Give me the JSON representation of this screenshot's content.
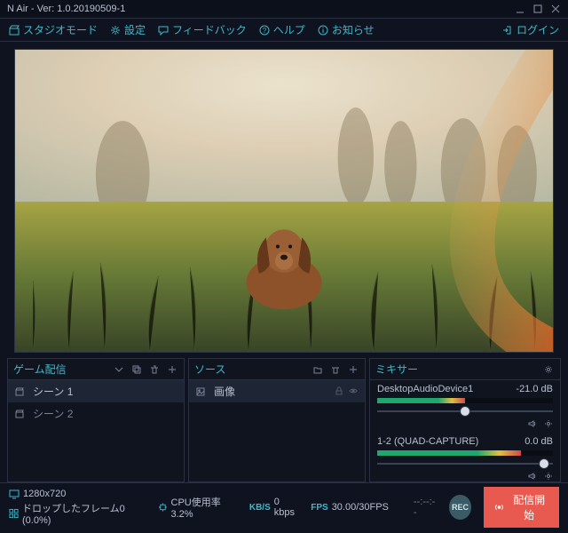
{
  "window": {
    "title": "N Air - Ver: 1.0.20190509-1"
  },
  "toolbar": {
    "studio": "スタジオモード",
    "settings": "設定",
    "feedback": "フィードバック",
    "help": "ヘルプ",
    "info": "お知らせ",
    "login": "ログイン"
  },
  "panels": {
    "scenes": {
      "title": "ゲーム配信",
      "items": [
        {
          "label": "シーン 1",
          "selected": true
        },
        {
          "label": "シーン 2",
          "selected": false
        }
      ]
    },
    "sources": {
      "title": "ソース",
      "items": [
        {
          "label": "画像",
          "selected": true
        }
      ]
    },
    "mixer": {
      "title": "ミキサー",
      "channels": [
        {
          "name": "DesktopAudioDevice1",
          "db": "-21.0 dB",
          "meter_pct": 50,
          "slider_pct": 50
        },
        {
          "name": "1-2 (QUAD-CAPTURE)",
          "db": "0.0 dB",
          "meter_pct": 82,
          "slider_pct": 95
        }
      ]
    }
  },
  "status": {
    "resolution": "1280x720",
    "cpu_label": "CPU使用率",
    "cpu_value": "3.2%",
    "dropped_label": "ドロップしたフレーム",
    "dropped_value": "0 (0.0%)",
    "kbps_label": "KB/S",
    "kbps_value": "0 kbps",
    "fps_label": "FPS",
    "fps_value": "30.00/30FPS",
    "timecode": "--:--:--",
    "rec": "REC",
    "go": "配信開始"
  }
}
